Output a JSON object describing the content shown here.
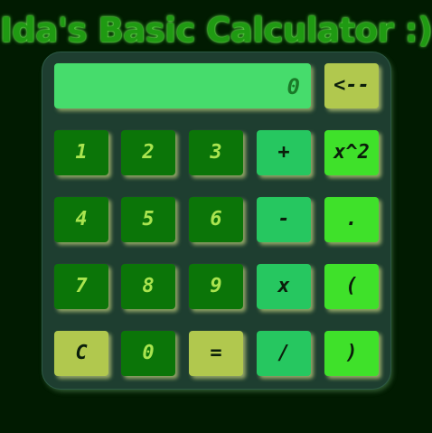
{
  "app": {
    "title": "Ida's Basic Calculator :)"
  },
  "display": {
    "value": "0"
  },
  "keys": {
    "backspace": "<--",
    "one": "1",
    "two": "2",
    "three": "3",
    "plus": "+",
    "square": "x^2",
    "four": "4",
    "five": "5",
    "six": "6",
    "minus": "-",
    "decimal": ".",
    "seven": "7",
    "eight": "8",
    "nine": "9",
    "multiply": "x",
    "open_paren": "(",
    "clear": "C",
    "zero": "0",
    "equals": "=",
    "divide": "/",
    "close_paren": ")"
  },
  "colors": {
    "background": "#011b01",
    "title": "#1f9a12",
    "calculator_body": "#1e3e30",
    "display": "#46dc6c",
    "number_key": "#0b7508",
    "operator_key": "#26c760",
    "bright_key": "#3fe12a",
    "lime_key": "#b1c84e"
  }
}
